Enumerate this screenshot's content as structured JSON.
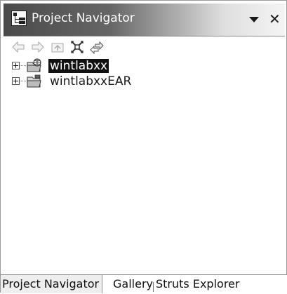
{
  "panel": {
    "title": "Project Navigator",
    "menu_icon": "view-menu-icon",
    "close_icon": "close-icon",
    "accent_gradient": [
      "#4a4a4a",
      "#f4f4f4"
    ]
  },
  "toolbar": {
    "buttons": [
      {
        "name": "back-icon",
        "enabled": false
      },
      {
        "name": "forward-icon",
        "enabled": false
      },
      {
        "name": "up-icon",
        "enabled": false
      },
      {
        "name": "collapse-all-icon",
        "enabled": true
      },
      {
        "name": "link-with-editor-icon",
        "enabled": true
      }
    ]
  },
  "tree": {
    "items": [
      {
        "label": "wintlabxx",
        "selected": true,
        "expanded": false,
        "icon": "web-project-icon"
      },
      {
        "label": "wintlabxxEAR",
        "selected": false,
        "expanded": false,
        "icon": "ear-project-icon"
      }
    ]
  },
  "tabs": [
    {
      "label": "Project Navigator",
      "active": true
    },
    {
      "label": "Gallery",
      "active": false
    },
    {
      "label": "Struts Explorer",
      "active": false
    }
  ]
}
